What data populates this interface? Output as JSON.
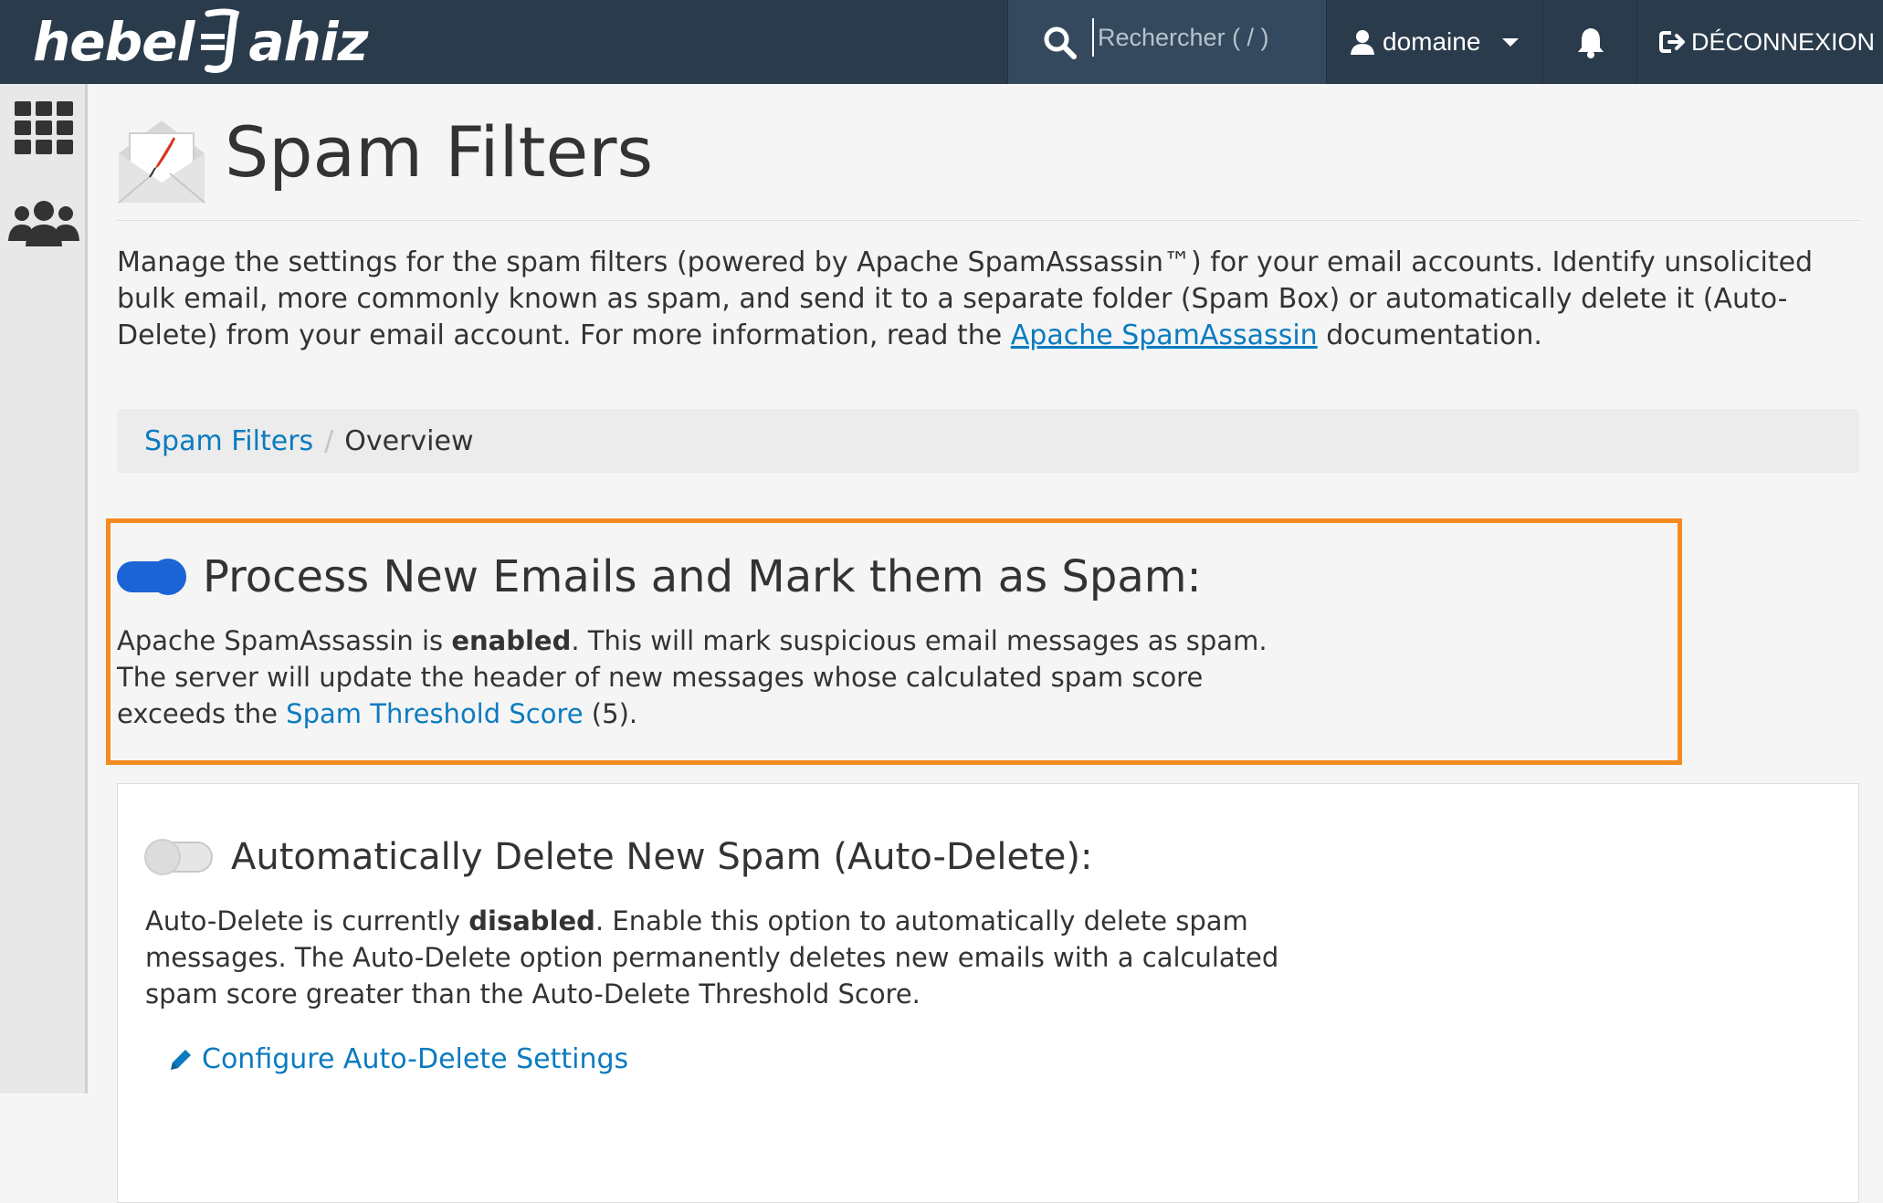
{
  "header": {
    "logo_left": "hebel",
    "logo_right": "ahiz",
    "search_placeholder": "Rechercher ( / )",
    "user_label": "domaine",
    "logout_label": "DÉCONNEXION"
  },
  "page": {
    "title": "Spam Filters",
    "intro_part1": "Manage the settings for the spam filters (powered by Apache SpamAssassin™) for your email accounts. Identify unsolicited bulk email, more commonly known as spam, and send it to a separate folder (Spam Box) or automatically delete it (Auto-Delete) from your email account. For more information, read the ",
    "intro_link": "Apache SpamAssassin",
    "intro_part2": " documentation."
  },
  "breadcrumb": {
    "root": "Spam Filters",
    "separator": "/",
    "current": "Overview"
  },
  "process_section": {
    "title": "Process New Emails and Mark them as Spam:",
    "toggle_on": true,
    "text_part1": "Apache SpamAssassin is ",
    "status_word": "enabled",
    "text_part2": ". This will mark suspicious email messages as spam. The server will update the header of new messages whose calculated spam score exceeds the ",
    "threshold_link": "Spam Threshold Score",
    "text_part3": " (5)."
  },
  "autodelete_section": {
    "title": "Automatically Delete New Spam (Auto-Delete):",
    "toggle_on": false,
    "text_part1": "Auto-Delete is currently ",
    "status_word": "disabled",
    "text_part2": ". Enable this option to automatically delete spam messages. The Auto-Delete option permanently deletes new emails with a calculated spam score greater than the Auto-Delete Threshold Score.",
    "configure_link": "Configure Auto-Delete Settings"
  },
  "colors": {
    "topbar": "#2a3b4c",
    "link": "#0b7bc0",
    "toggle_on": "#1b64d6",
    "highlight": "#f58a1f"
  },
  "icons": [
    "search-icon",
    "user-icon",
    "chevron-down-icon",
    "bell-icon",
    "logout-icon",
    "apps-grid-icon",
    "users-icon",
    "mail-quill-icon",
    "pencil-icon"
  ]
}
